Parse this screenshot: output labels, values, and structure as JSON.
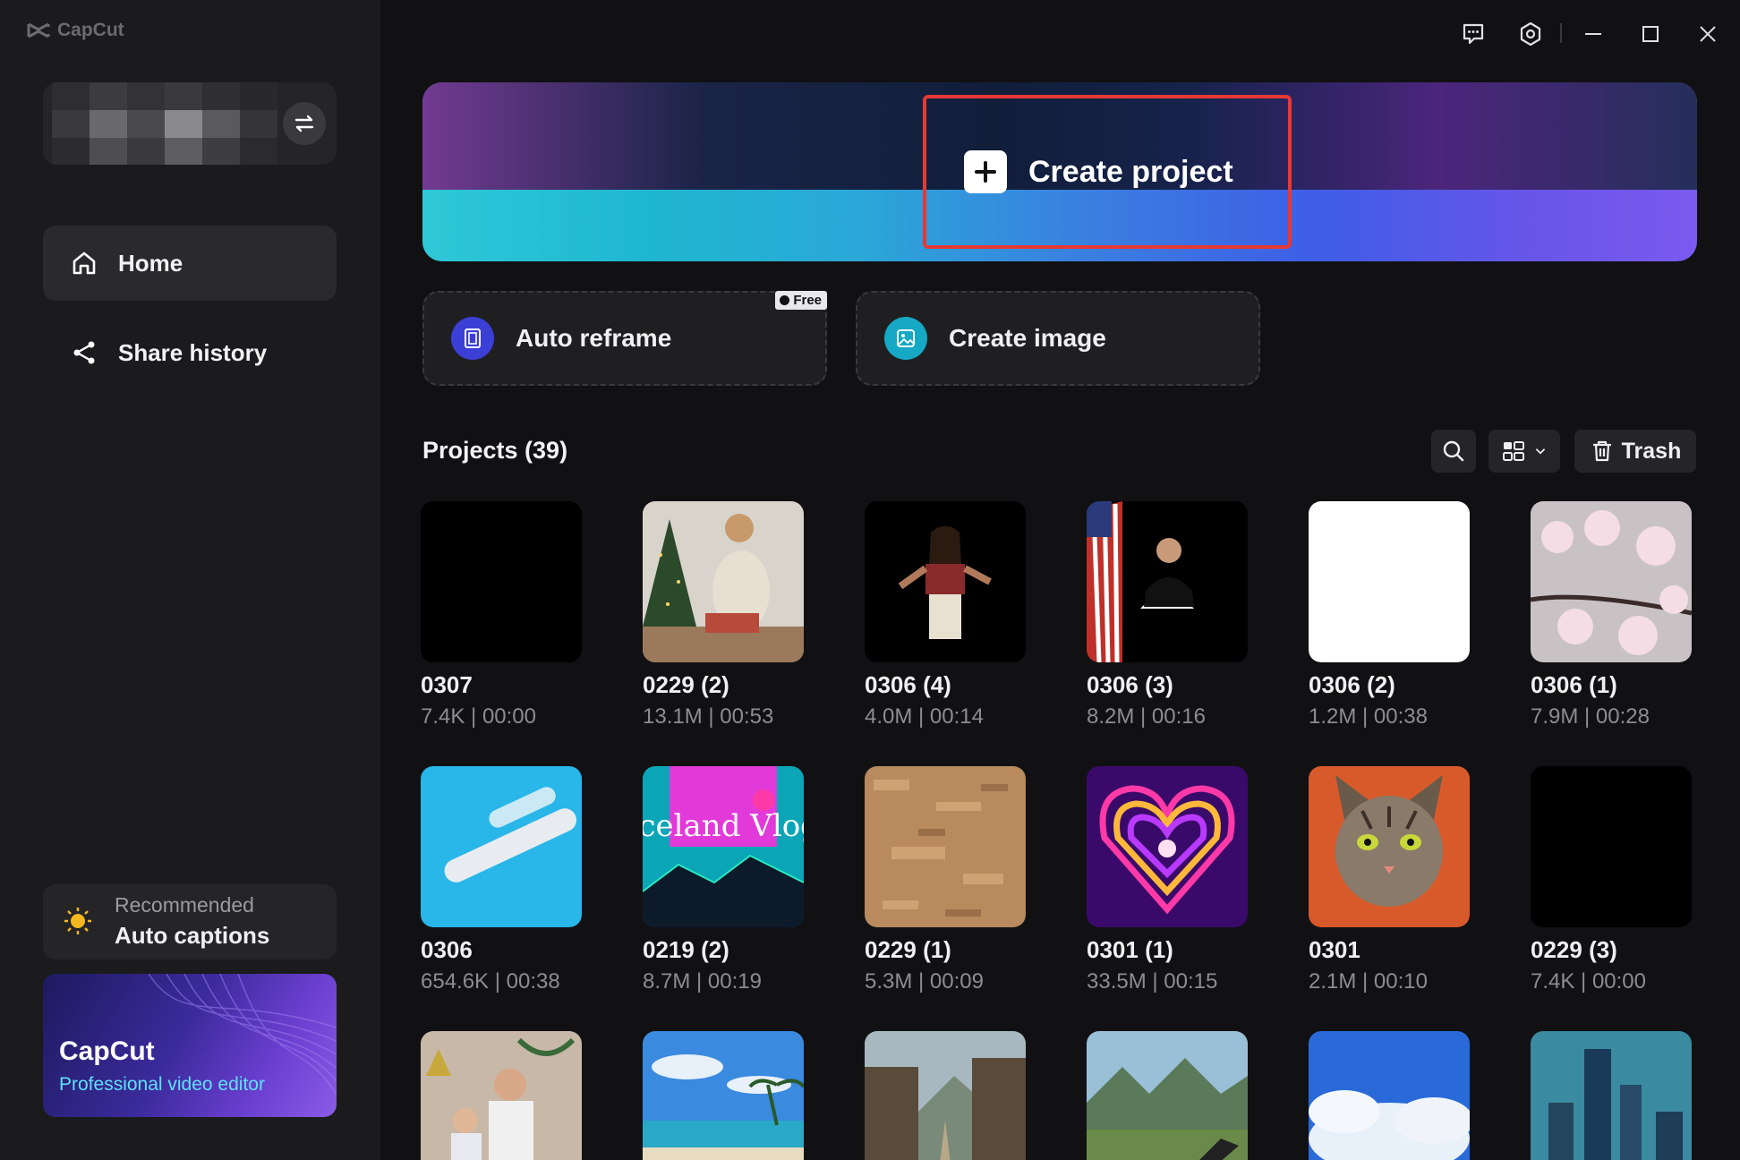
{
  "app": {
    "logo_text": "CapCut"
  },
  "sidebar": {
    "nav": [
      {
        "label": "Home",
        "icon": "home-icon"
      },
      {
        "label": "Share history",
        "icon": "share-icon"
      }
    ],
    "recommended": {
      "sub": "Recommended",
      "title": "Auto captions"
    },
    "promo": {
      "title": "CapCut",
      "subtitle": "Professional video editor"
    }
  },
  "hero": {
    "create_label": "Create project"
  },
  "tools": [
    {
      "label": "Auto reframe",
      "badge": "Free",
      "accent": "#3b3fd6"
    },
    {
      "label": "Create image",
      "accent": "#16a8c4"
    }
  ],
  "projects": {
    "title": "Projects  (39)",
    "trash_label": "Trash",
    "items": [
      {
        "name": "0307",
        "meta": "7.4K | 00:00"
      },
      {
        "name": "0229 (2)",
        "meta": "13.1M | 00:53"
      },
      {
        "name": "0306 (4)",
        "meta": "4.0M | 00:14"
      },
      {
        "name": "0306 (3)",
        "meta": "8.2M | 00:16"
      },
      {
        "name": "0306 (2)",
        "meta": "1.2M | 00:38"
      },
      {
        "name": "0306 (1)",
        "meta": "7.9M | 00:28"
      },
      {
        "name": "0306",
        "meta": "654.6K | 00:38"
      },
      {
        "name": "0219 (2)",
        "meta": "8.7M | 00:19",
        "thumb_text": "Iceland Vlog"
      },
      {
        "name": "0229 (1)",
        "meta": "5.3M | 00:09"
      },
      {
        "name": "0301 (1)",
        "meta": "33.5M | 00:15"
      },
      {
        "name": "0301",
        "meta": "2.1M | 00:10"
      },
      {
        "name": "0229 (3)",
        "meta": "7.4K | 00:00"
      },
      {
        "name": "",
        "meta": ""
      },
      {
        "name": "",
        "meta": ""
      },
      {
        "name": "",
        "meta": ""
      },
      {
        "name": "",
        "meta": ""
      },
      {
        "name": "",
        "meta": ""
      },
      {
        "name": "",
        "meta": ""
      }
    ]
  }
}
